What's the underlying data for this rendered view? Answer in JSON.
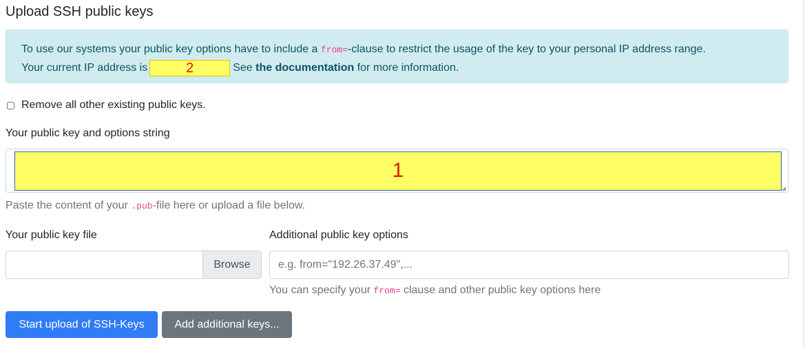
{
  "page": {
    "title": "Upload SSH public keys"
  },
  "alert": {
    "text_before_code": "To use our systems your public key options have to include a ",
    "code": "from=",
    "text_after_code": "-clause to restrict the usage of the key to your personal IP address range.",
    "ip_prefix": "Your current IP address is",
    "ip_marker": "2",
    "see_text": "See ",
    "doc_link": "the documentation",
    "after_link": " for more information."
  },
  "remove_keys": {
    "label": "Remove all other existing public keys.",
    "checked": false
  },
  "key_string": {
    "label": "Your public key and options string",
    "marker": "1",
    "help_before": "Paste the content of your ",
    "help_code": ".pub",
    "help_after": "-file here or upload a file below."
  },
  "key_file": {
    "label": "Your public key file",
    "value": "",
    "browse_label": "Browse"
  },
  "key_options": {
    "label": "Additional public key options",
    "placeholder": "e.g. from=\"192.26.37.49\",...",
    "help_before": "You can specify your ",
    "help_code": "from=",
    "help_after": " clause and other public key options here"
  },
  "buttons": {
    "start_upload": "Start upload of SSH-Keys",
    "add_keys": "Add additional keys..."
  },
  "colors": {
    "primary": "#2f7cf6",
    "secondary": "#6c757d",
    "alert_bg": "#d1ecf1",
    "highlight": "#ffff66"
  }
}
